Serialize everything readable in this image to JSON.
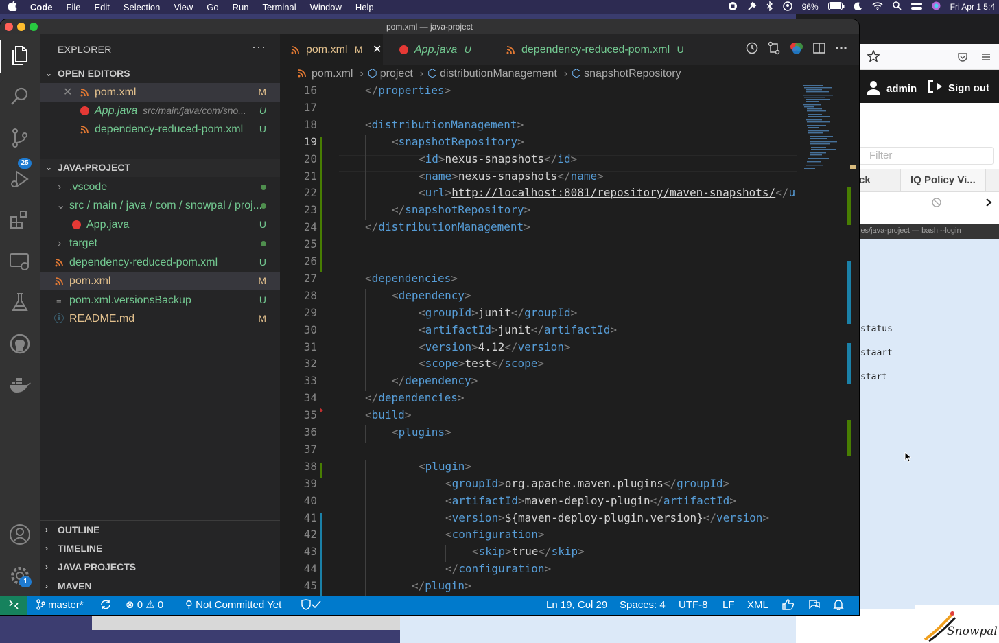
{
  "menubar": {
    "app": "Code",
    "items": [
      "File",
      "Edit",
      "Selection",
      "View",
      "Go",
      "Run",
      "Terminal",
      "Window",
      "Help"
    ],
    "battery": "96%",
    "clock": "Fri Apr 1  5:4"
  },
  "window": {
    "title": "pom.xml — java-project"
  },
  "explorer": {
    "title": "EXPLORER",
    "more": "···",
    "open_editors": {
      "title": "OPEN EDITORS",
      "items": [
        {
          "name": "pom.xml",
          "status": "M",
          "path": ""
        },
        {
          "name": "App.java",
          "status": "U",
          "path": "src/main/java/com/sno..."
        },
        {
          "name": "dependency-reduced-pom.xml",
          "status": "U",
          "path": ""
        }
      ]
    },
    "project": {
      "title": "JAVA-PROJECT",
      "items": [
        {
          "name": ".vscode"
        },
        {
          "name": "src / main / java / com / snowpal / proj..."
        },
        {
          "name": "App.java",
          "status": "U"
        },
        {
          "name": "target"
        },
        {
          "name": "dependency-reduced-pom.xml",
          "status": "U"
        },
        {
          "name": "pom.xml",
          "status": "M"
        },
        {
          "name": "pom.xml.versionsBackup",
          "status": "U"
        },
        {
          "name": "README.md",
          "status": "M"
        }
      ]
    },
    "sections": [
      "OUTLINE",
      "TIMELINE",
      "JAVA PROJECTS",
      "MAVEN"
    ]
  },
  "activity": {
    "scm_badge": "25",
    "settings_badge": "1"
  },
  "tabs": [
    {
      "name": "pom.xml",
      "status": "M"
    },
    {
      "name": "App.java",
      "status": "U"
    },
    {
      "name": "dependency-reduced-pom.xml",
      "status": "U"
    }
  ],
  "breadcrumb": [
    "pom.xml",
    "project",
    "distributionManagement",
    "snapshotRepository"
  ],
  "editor": {
    "first_line": 16,
    "current_line": 19,
    "lines": [
      [
        [
          "b",
          "</"
        ],
        [
          "tag",
          "properties"
        ],
        [
          "b",
          ">"
        ]
      ],
      [],
      [
        [
          "b",
          "<"
        ],
        [
          "tag",
          "distributionManagement"
        ],
        [
          "b",
          ">"
        ]
      ],
      [
        [
          "b",
          "<"
        ],
        [
          "tag",
          "snapshotRepository"
        ],
        [
          "b",
          ">"
        ]
      ],
      [
        [
          "b",
          "<"
        ],
        [
          "tag",
          "id"
        ],
        [
          "b",
          ">"
        ],
        [
          "txt",
          "nexus-snapshots"
        ],
        [
          "b",
          "</"
        ],
        [
          "tag",
          "id"
        ],
        [
          "b",
          ">"
        ]
      ],
      [
        [
          "b",
          "<"
        ],
        [
          "tag",
          "name"
        ],
        [
          "b",
          ">"
        ],
        [
          "txt",
          "nexus-snapshots"
        ],
        [
          "b",
          "</"
        ],
        [
          "tag",
          "name"
        ],
        [
          "b",
          ">"
        ]
      ],
      [
        [
          "b",
          "<"
        ],
        [
          "tag",
          "url"
        ],
        [
          "b",
          ">"
        ],
        [
          "url",
          "http://localhost:8081/repository/maven-snapshots/"
        ],
        [
          "b",
          "</"
        ],
        [
          "tag",
          "u"
        ]
      ],
      [
        [
          "b",
          "</"
        ],
        [
          "tag",
          "snapshotRepository"
        ],
        [
          "b",
          ">"
        ]
      ],
      [
        [
          "b",
          "</"
        ],
        [
          "tag",
          "distributionManagement"
        ],
        [
          "b",
          ">"
        ]
      ],
      [],
      [],
      [
        [
          "b",
          "<"
        ],
        [
          "tag",
          "dependencies"
        ],
        [
          "b",
          ">"
        ]
      ],
      [
        [
          "b",
          "<"
        ],
        [
          "tag",
          "dependency"
        ],
        [
          "b",
          ">"
        ]
      ],
      [
        [
          "b",
          "<"
        ],
        [
          "tag",
          "groupId"
        ],
        [
          "b",
          ">"
        ],
        [
          "txt",
          "junit"
        ],
        [
          "b",
          "</"
        ],
        [
          "tag",
          "groupId"
        ],
        [
          "b",
          ">"
        ]
      ],
      [
        [
          "b",
          "<"
        ],
        [
          "tag",
          "artifactId"
        ],
        [
          "b",
          ">"
        ],
        [
          "txt",
          "junit"
        ],
        [
          "b",
          "</"
        ],
        [
          "tag",
          "artifactId"
        ],
        [
          "b",
          ">"
        ]
      ],
      [
        [
          "b",
          "<"
        ],
        [
          "tag",
          "version"
        ],
        [
          "b",
          ">"
        ],
        [
          "txt",
          "4.12"
        ],
        [
          "b",
          "</"
        ],
        [
          "tag",
          "version"
        ],
        [
          "b",
          ">"
        ]
      ],
      [
        [
          "b",
          "<"
        ],
        [
          "tag",
          "scope"
        ],
        [
          "b",
          ">"
        ],
        [
          "txt",
          "test"
        ],
        [
          "b",
          "</"
        ],
        [
          "tag",
          "scope"
        ],
        [
          "b",
          ">"
        ]
      ],
      [
        [
          "b",
          "</"
        ],
        [
          "tag",
          "dependency"
        ],
        [
          "b",
          ">"
        ]
      ],
      [
        [
          "b",
          "</"
        ],
        [
          "tag",
          "dependencies"
        ],
        [
          "b",
          ">"
        ]
      ],
      [
        [
          "b",
          "<"
        ],
        [
          "tag",
          "build"
        ],
        [
          "b",
          ">"
        ]
      ],
      [
        [
          "b",
          "<"
        ],
        [
          "tag",
          "plugins"
        ],
        [
          "b",
          ">"
        ]
      ],
      [],
      [
        [
          "b",
          "<"
        ],
        [
          "tag",
          "plugin"
        ],
        [
          "b",
          ">"
        ]
      ],
      [
        [
          "b",
          "<"
        ],
        [
          "tag",
          "groupId"
        ],
        [
          "b",
          ">"
        ],
        [
          "txt",
          "org.apache.maven.plugins"
        ],
        [
          "b",
          "</"
        ],
        [
          "tag",
          "groupId"
        ],
        [
          "b",
          ">"
        ]
      ],
      [
        [
          "b",
          "<"
        ],
        [
          "tag",
          "artifactId"
        ],
        [
          "b",
          ">"
        ],
        [
          "txt",
          "maven-deploy-plugin"
        ],
        [
          "b",
          "</"
        ],
        [
          "tag",
          "artifactId"
        ],
        [
          "b",
          ">"
        ]
      ],
      [
        [
          "b",
          "<"
        ],
        [
          "tag",
          "version"
        ],
        [
          "b",
          ">"
        ],
        [
          "txt",
          "${maven-deploy-plugin.version}"
        ],
        [
          "b",
          "</"
        ],
        [
          "tag",
          "version"
        ],
        [
          "b",
          ">"
        ]
      ],
      [
        [
          "b",
          "<"
        ],
        [
          "tag",
          "configuration"
        ],
        [
          "b",
          ">"
        ]
      ],
      [
        [
          "b",
          "<"
        ],
        [
          "tag",
          "skip"
        ],
        [
          "b",
          ">"
        ],
        [
          "txt",
          "true"
        ],
        [
          "b",
          "</"
        ],
        [
          "tag",
          "skip"
        ],
        [
          "b",
          ">"
        ]
      ],
      [
        [
          "b",
          "</"
        ],
        [
          "tag",
          "configuration"
        ],
        [
          "b",
          ">"
        ]
      ],
      [
        [
          "b",
          "</"
        ],
        [
          "tag",
          "plugin"
        ],
        [
          "b",
          ">"
        ]
      ]
    ]
  },
  "statusbar": {
    "branch": "master*",
    "errors": "0",
    "warnings": "0",
    "commit": "Not Committed Yet",
    "position": "Ln 19, Col 29",
    "spaces": "Spaces: 4",
    "encoding": "UTF-8",
    "eol": "LF",
    "language": "XML"
  },
  "browser": {
    "user": "admin",
    "signout": "Sign out",
    "filter_placeholder": "Filter",
    "tab_partial": "ck",
    "tab_iq": "IQ Policy Vi...",
    "terminal_title": "les/java-project — bash --login",
    "terminal_lines": [
      "status",
      "staart",
      "start"
    ],
    "logo": "Snowpal"
  },
  "colors": {
    "accent": "#007acc",
    "modified": "#e2c08d",
    "untracked": "#73c991",
    "tag": "#569cd6"
  }
}
